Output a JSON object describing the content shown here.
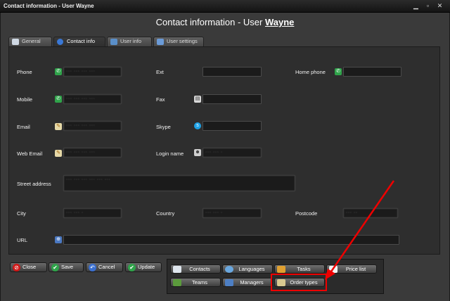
{
  "window": {
    "title": "Contact information - User Wayne"
  },
  "header": {
    "prefix": "Contact information - User ",
    "user": "Wayne"
  },
  "tabs": [
    {
      "label": "General"
    },
    {
      "label": "Contact info"
    },
    {
      "label": "User info"
    },
    {
      "label": "User settings"
    }
  ],
  "fields": {
    "phone": {
      "label": "Phone",
      "value": "··· ··· ··· ···"
    },
    "ext": {
      "label": "Ext",
      "value": ""
    },
    "home_phone": {
      "label": "Home phone",
      "value": ""
    },
    "mobile": {
      "label": "Mobile",
      "value": "··· ··· ··· ···"
    },
    "fax": {
      "label": "Fax",
      "value": ""
    },
    "email": {
      "label": "Email",
      "value": "··· ··· ··· ···"
    },
    "skype": {
      "label": "Skype",
      "value": ""
    },
    "web_email": {
      "label": "Web Email",
      "value": "··· ··· ··· ···"
    },
    "login_name": {
      "label": "Login name",
      "value": "··· ··· ·"
    },
    "street_address": {
      "label": "Street address",
      "value": "··· ··· ··· ··· ··· ···"
    },
    "city": {
      "label": "City",
      "value": "··· ··· ·"
    },
    "country": {
      "label": "Country",
      "value": "··· ··· ·"
    },
    "postcode": {
      "label": "Postcode",
      "value": "··· ··"
    },
    "url": {
      "label": "URL",
      "value": ""
    }
  },
  "actions": {
    "close": "Close",
    "save": "Save",
    "cancel": "Cancel",
    "update": "Update"
  },
  "links": {
    "contacts": "Contacts",
    "languages": "Languages",
    "tasks": "Tasks",
    "price_list": "Price list",
    "teams": "Teams",
    "managers": "Managers",
    "order_types": "Order types"
  },
  "colors": {
    "highlight": "#e00000",
    "arrow": "#e00000"
  }
}
